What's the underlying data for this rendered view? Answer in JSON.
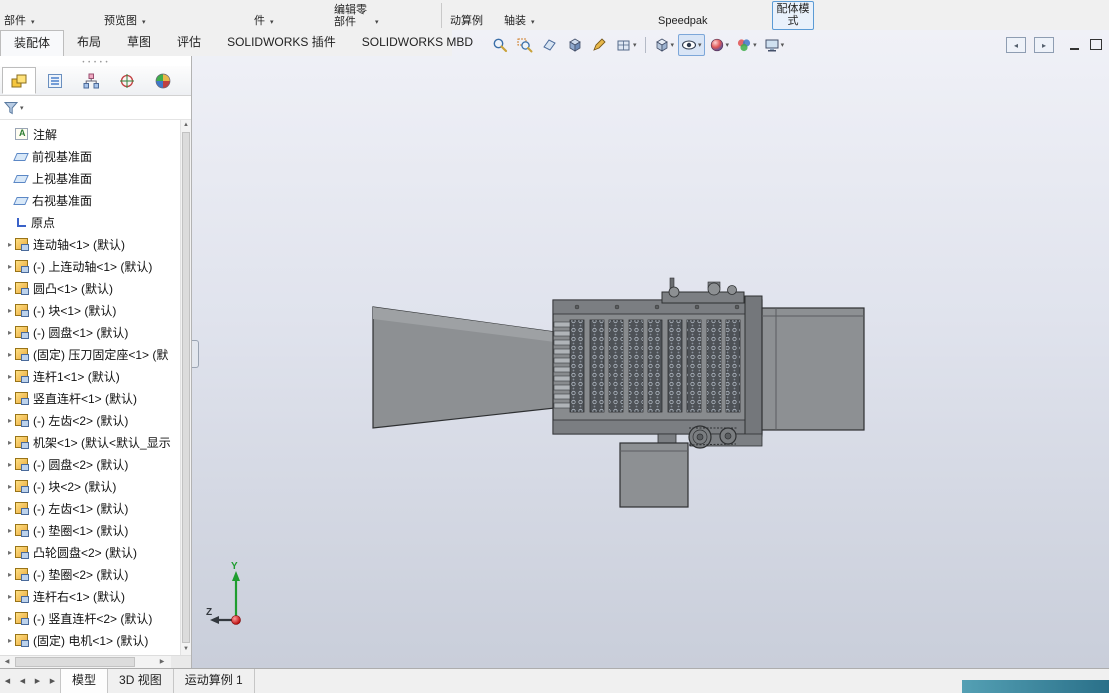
{
  "colors": {
    "accent": "#5b9bd5",
    "viewport_top": "#f0f1f7",
    "viewport_bottom": "#c9ceda",
    "model_gray": "#8d9093",
    "status_teal": "#2a7089"
  },
  "ribbon": {
    "buttons": [
      {
        "label": "部件",
        "caret": true
      },
      {
        "label": "预览图",
        "caret": true
      },
      {
        "label": "件",
        "caret": true
      },
      {
        "label": "编辑零部件",
        "caret": true
      },
      {
        "label": "动算例",
        "caret": false
      },
      {
        "label": "轴装",
        "caret": true
      },
      {
        "label": "Speedpak",
        "caret": false
      },
      {
        "label": "配体模式",
        "caret": false,
        "pressed": true
      }
    ]
  },
  "command_tabs": {
    "items": [
      {
        "label": "装配体",
        "active": true
      },
      {
        "label": "布局"
      },
      {
        "label": "草图"
      },
      {
        "label": "评估"
      },
      {
        "label": "SOLIDWORKS 插件"
      },
      {
        "label": "SOLIDWORKS MBD"
      }
    ]
  },
  "viewbar": {
    "icons": [
      {
        "name": "zoom-fit"
      },
      {
        "name": "zoom-area"
      },
      {
        "name": "previous-view"
      },
      {
        "name": "section-view"
      },
      {
        "name": "annotation-pencil"
      },
      {
        "name": "display-style",
        "caret": true
      },
      {
        "name": "view-orientation",
        "caret": true
      },
      {
        "name": "hide-show-items",
        "caret": true,
        "pressed": true
      },
      {
        "name": "edit-appearance",
        "caret": true
      },
      {
        "name": "apply-scene",
        "caret": true
      },
      {
        "name": "view-settings",
        "caret": true
      }
    ]
  },
  "window_icons": [
    "collapse-left-pane",
    "collapse-right-pane",
    "minimize",
    "restore"
  ],
  "panel": {
    "manager_tabs": [
      "featuremanager",
      "propertymanager",
      "configurationmanager",
      "dimxpert",
      "displaymanager"
    ],
    "filter_icon": "filter-funnel",
    "tree": {
      "items": [
        {
          "type": "annotation",
          "label": "注解"
        },
        {
          "type": "plane",
          "label": "前视基准面"
        },
        {
          "type": "plane",
          "label": "上视基准面"
        },
        {
          "type": "plane",
          "label": "右视基准面"
        },
        {
          "type": "origin",
          "label": "原点"
        },
        {
          "type": "component",
          "label": "连动轴<1> (默认)"
        },
        {
          "type": "component",
          "label": "(-) 上连动轴<1> (默认)"
        },
        {
          "type": "component",
          "label": "圆凸<1> (默认)"
        },
        {
          "type": "component",
          "label": "(-) 块<1> (默认)"
        },
        {
          "type": "component",
          "label": "(-) 圆盘<1> (默认)"
        },
        {
          "type": "component",
          "label": "(固定) 压刀固定座<1> (默"
        },
        {
          "type": "component",
          "label": "连杆1<1> (默认)"
        },
        {
          "type": "component",
          "label": "竖直连杆<1> (默认)"
        },
        {
          "type": "component",
          "label": "(-) 左齿<2> (默认)"
        },
        {
          "type": "component",
          "label": "机架<1> (默认<默认_显示"
        },
        {
          "type": "component",
          "label": "(-) 圆盘<2> (默认)"
        },
        {
          "type": "component",
          "label": "(-) 块<2> (默认)"
        },
        {
          "type": "component",
          "label": "(-) 左齿<1> (默认)"
        },
        {
          "type": "component",
          "label": "(-) 垫圈<1> (默认)"
        },
        {
          "type": "component",
          "label": "凸轮圆盘<2> (默认)"
        },
        {
          "type": "component",
          "label": "(-) 垫圈<2> (默认)"
        },
        {
          "type": "component",
          "label": "连杆右<1> (默认)"
        },
        {
          "type": "component",
          "label": "(-) 竖直连杆<2> (默认)"
        },
        {
          "type": "component",
          "label": "(固定) 电机<1> (默认)"
        }
      ]
    }
  },
  "bottom": {
    "nav_icons": [
      "go-first",
      "go-prev",
      "go-next",
      "go-last"
    ],
    "tabs": [
      {
        "label": "模型",
        "active": true
      },
      {
        "label": "3D 视图"
      },
      {
        "label": "运动算例 1"
      }
    ]
  },
  "triad": {
    "y": "Y",
    "z": "Z"
  }
}
